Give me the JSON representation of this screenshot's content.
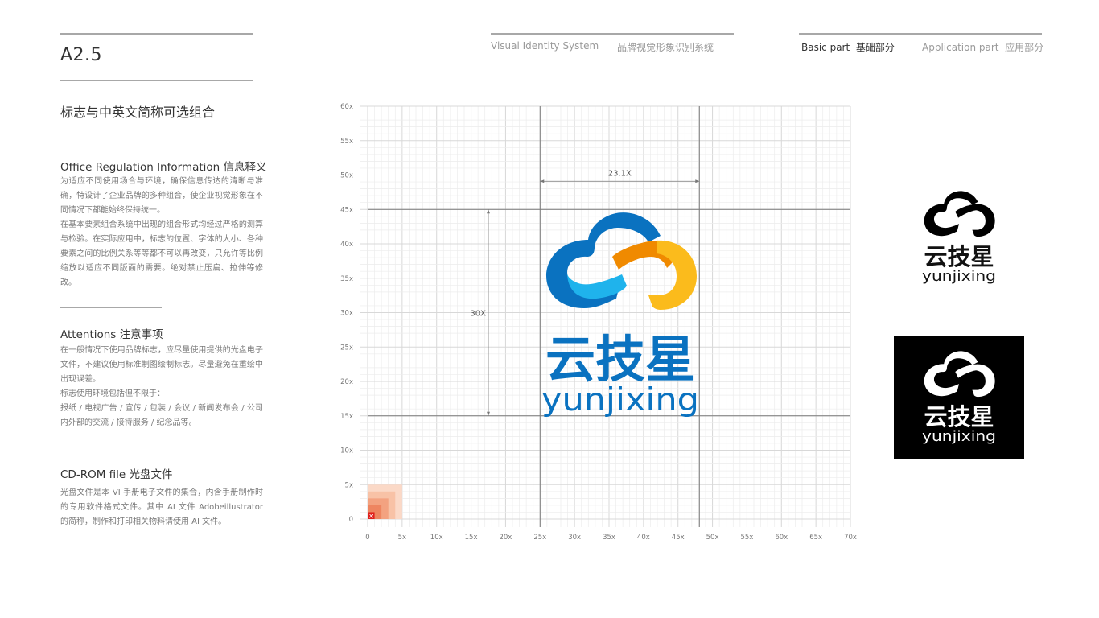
{
  "header": {
    "page_code": "A2.5",
    "page_title": "标志与中英文简称可选组合",
    "nav": {
      "vis_en": "Visual Identity System",
      "vis_cn": "品牌视觉形象识别系统",
      "basic_en": "Basic part",
      "basic_cn": "基础部分",
      "app_en": "Application part",
      "app_cn": "应用部分",
      "active": "basic"
    }
  },
  "sections": [
    {
      "title": "Office Regulation Information 信息释义",
      "paragraphs": [
        "为适应不同使用场合与环境，确保信息传达的清晰与准确，特设计了企业品牌的多种组合，使企业视觉形象在不同情况下都能始终保持统一。",
        "在基本要素组合系统中出现的组合形式均经过严格的测算与检验。在实际应用中，标志的位置、字体的大小、各种要素之间的比例关系等等都不可以再改变，只允许等比例缩放以适应不同版面的需要。绝对禁止压扁、拉伸等修改。"
      ]
    },
    {
      "title": "Attentions 注意事项",
      "paragraphs": [
        "在一般情况下使用品牌标志，应尽量使用提供的光盘电子文件，不建议使用标准制图绘制标志。尽量避免在重绘中出现误差。",
        "标志使用环境包括但不限于：",
        "报纸 / 电视广告 / 宣传 / 包装 / 会议 / 新闻发布会 / 公司内外部的交流 / 接待服务 / 纪念品等。"
      ]
    },
    {
      "title": "CD-ROM file 光盘文件",
      "paragraphs": [
        "光盘文件是本 VI 手册电子文件的集合，内含手册制作时的专用软件格式文件。其中 AI 文件 Adobeillustrator 的简称，制作和打印相关物料请使用 AI 文件。"
      ]
    }
  ],
  "grid": {
    "x_ticks": [
      "0",
      "5x",
      "10x",
      "15x",
      "20x",
      "25x",
      "30x",
      "35x",
      "40x",
      "45x",
      "50x",
      "55x",
      "60x",
      "65x",
      "70x"
    ],
    "y_ticks": [
      "0",
      "5x",
      "10x",
      "15x",
      "20x",
      "25x",
      "30x",
      "35x",
      "40x",
      "45x",
      "50x",
      "55x",
      "60x"
    ],
    "x_range": [
      0,
      70
    ],
    "y_range": [
      0,
      60
    ],
    "guides": {
      "vertical": [
        25,
        48.1
      ],
      "horizontal": [
        15,
        45
      ]
    },
    "dimensions": {
      "width_label": "23.1X",
      "height_label": "30X"
    },
    "unit_marker": "x",
    "unit_marker_color": "#e0201b",
    "unit_squares_color": "#f07a50"
  },
  "logo": {
    "name_cn": "云技星",
    "name_en": "yunjixing",
    "colors": {
      "blue_dark": "#0a72c0",
      "blue_light": "#1fb3ec",
      "orange": "#f08a00",
      "yellow": "#fbbb1c",
      "text_blue": "#0a72c0"
    }
  },
  "variants": [
    {
      "label": "black-on-white",
      "name_cn": "云技星",
      "name_en": "yunjixing"
    },
    {
      "label": "white-on-black",
      "name_cn": "云技星",
      "name_en": "yunjixing"
    }
  ]
}
